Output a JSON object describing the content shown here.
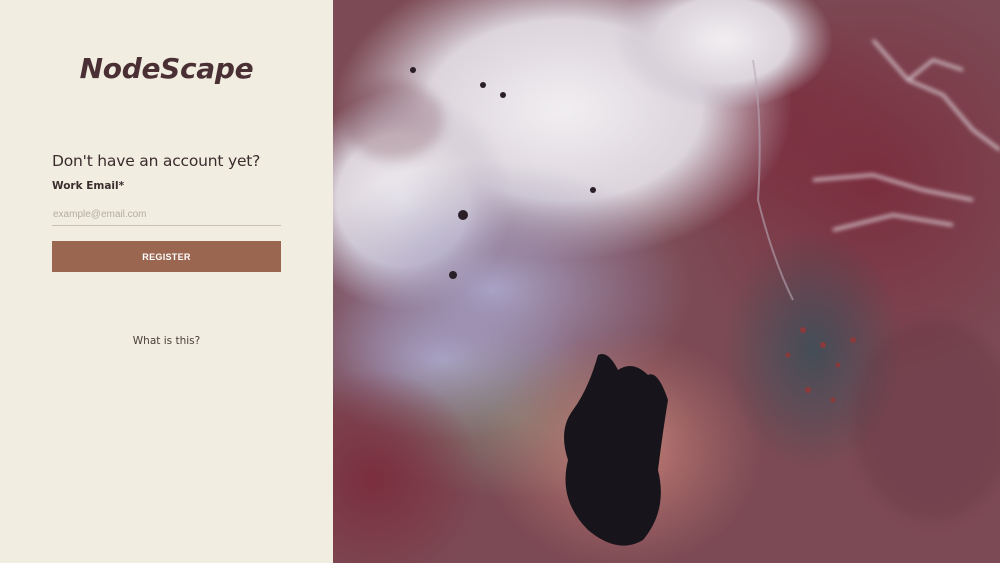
{
  "brand": {
    "name": "NodeScape"
  },
  "form": {
    "title": "Don't have an account yet?",
    "email_label": "Work Email*",
    "email_placeholder": "example@email.com",
    "email_value": "",
    "register_label": "REGISTER"
  },
  "footer": {
    "what_is_this": "What is this?"
  },
  "colors": {
    "panel_background": "#f1ede0",
    "brand_text": "#4a3034",
    "button_background": "#9a6650",
    "button_text": "#ffffff"
  },
  "hero": {
    "image": "satellite-desert-terrain"
  }
}
